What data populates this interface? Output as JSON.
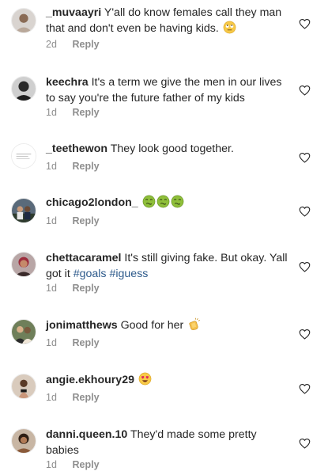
{
  "comments": [
    {
      "username": "_muvaayri",
      "text": "Y'all do know females call they man that and don't even be having kids.",
      "emojis": [
        "eye-roll-emoji"
      ],
      "time": "2d",
      "reply": "Reply"
    },
    {
      "username": "keechra",
      "text": "It's a term we give the men in our lives to say you're the future father of my kids",
      "time": "1d",
      "reply": "Reply"
    },
    {
      "username": "_teethewon",
      "text": "They look good together.",
      "time": "1d",
      "reply": "Reply"
    },
    {
      "username": "chicago2london_",
      "text": "",
      "emojis": [
        "nauseated-face-emoji",
        "nauseated-face-emoji",
        "nauseated-face-emoji"
      ],
      "time": "1d",
      "reply": "Reply"
    },
    {
      "username": "chettacaramel",
      "text": "It's still giving fake. But okay. Yall got it",
      "hashtags": [
        "#goals",
        "#iguess"
      ],
      "time": "1d",
      "reply": "Reply"
    },
    {
      "username": "jonimatthews",
      "text": "Good for her",
      "emojis": [
        "clapping-hands-emoji"
      ],
      "time": "1d",
      "reply": "Reply"
    },
    {
      "username": "angie.ekhoury29",
      "text": "",
      "emojis": [
        "heart-eyes-emoji"
      ],
      "time": "1d",
      "reply": "Reply"
    },
    {
      "username": "danni.queen.10",
      "text": "They'd made some pretty babies",
      "time": "1d",
      "reply": "Reply"
    }
  ],
  "icons": {
    "like": "heart-outline-icon"
  },
  "colors": {
    "text": "#262626",
    "meta": "#8e8e8e",
    "hashtag": "#2d5a8b"
  }
}
